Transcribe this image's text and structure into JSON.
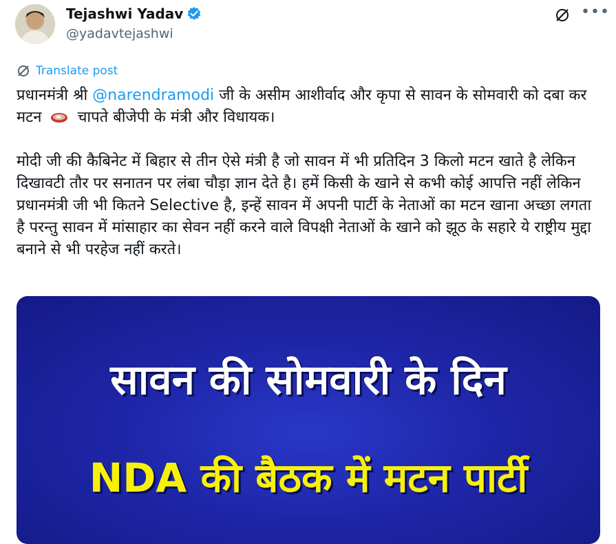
{
  "author": {
    "display_name": "Tejashwi Yadav",
    "handle": "@yadavtejashwi",
    "verified": true
  },
  "header_icons": [
    "grok-icon",
    "more-icon"
  ],
  "translate_label": "Translate post",
  "tweet": {
    "p1_part1": "प्रधानमंत्री श्री ",
    "p1_mention": "@narendramodi",
    "p1_part2": " जी के असीम आशीर्वाद और कृपा से सावन के सोमवारी को दबा कर मटन ",
    "p1_emoji": "meat-emoji",
    "p1_part3": " चापते बीजेपी के मंत्री और विधायक।",
    "p2": "मोदी जी की कैबिनेट में बिहार से तीन ऐसे मंत्री है जो सावन में भी प्रतिदिन 3 किलो मटन खाते है लेकिन दिखावटी तौर पर सनातन पर लंबा चौड़ा ज्ञान देते है। हमें किसी के खाने से कभी कोई आपत्ति नहीं लेकिन प्रधानमंत्री जी भी कितने Selective है, इन्हें सावन में अपनी पार्टी के नेताओं का मटन खाना अच्छा लगता है परन्तु सावन में मांसाहार का सेवन नहीं करने वाले विपक्षी नेताओं के खाने को झूठ के सहारे ये राष्ट्रीय मुद्दा बनाने से भी परहेज नहीं करते।"
  },
  "media": {
    "line1": "सावन की सोमवारी के दिन",
    "line2": "NDA की बैठक में मटन पार्टी",
    "colors": {
      "background": "#1e26a8",
      "line1": "#ffffff",
      "line2": "#f7f10a"
    }
  },
  "colors": {
    "link": "#1d9bf0",
    "text": "#0f1419",
    "muted": "#536471"
  }
}
